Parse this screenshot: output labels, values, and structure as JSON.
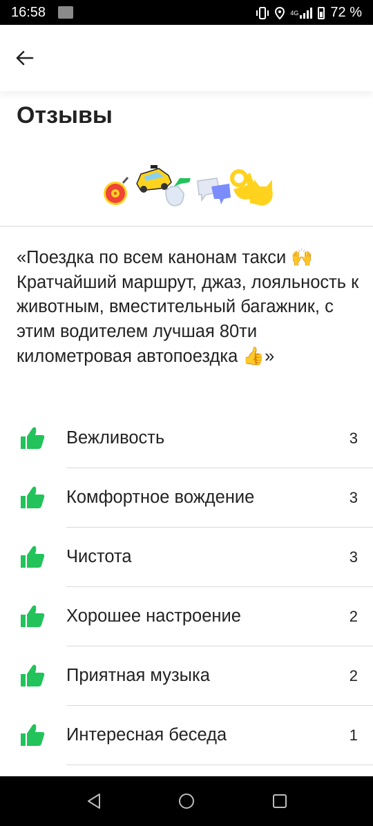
{
  "status_bar": {
    "time": "16:58",
    "network": "4G",
    "battery": "72 %"
  },
  "header": {
    "back_icon": "arrow-left-icon"
  },
  "page": {
    "title": "Отзывы"
  },
  "badges": [
    "vinyl-record-icon",
    "taxi-car-icon",
    "spray-bottle-icon",
    "chat-bubbles-icon",
    "ok-hand-icon",
    "cat-icon"
  ],
  "review": {
    "text": "«Поездка по всем канонам такси 🙌 Кратчайший маршрут, джаз, лояльность к животным, вместительный багажник, с этим водителем лучшая 80ти километровая автопоездка 👍»"
  },
  "criteria": [
    {
      "label": "Вежливость",
      "count": "3",
      "icon": "thumbs-up-icon"
    },
    {
      "label": "Комфортное вождение",
      "count": "3",
      "icon": "thumbs-up-icon"
    },
    {
      "label": "Чистота",
      "count": "3",
      "icon": "thumbs-up-icon"
    },
    {
      "label": "Хорошее настроение",
      "count": "2",
      "icon": "thumbs-up-icon"
    },
    {
      "label": "Приятная музыка",
      "count": "2",
      "icon": "thumbs-up-icon"
    },
    {
      "label": "Интересная беседа",
      "count": "1",
      "icon": "thumbs-up-icon"
    }
  ],
  "colors": {
    "accent_green": "#21c35a",
    "badge_yellow": "#ffd21e",
    "badge_red": "#f04438"
  },
  "nav_bar": {
    "icons": [
      "back-triangle-icon",
      "home-circle-icon",
      "recents-square-icon"
    ]
  }
}
